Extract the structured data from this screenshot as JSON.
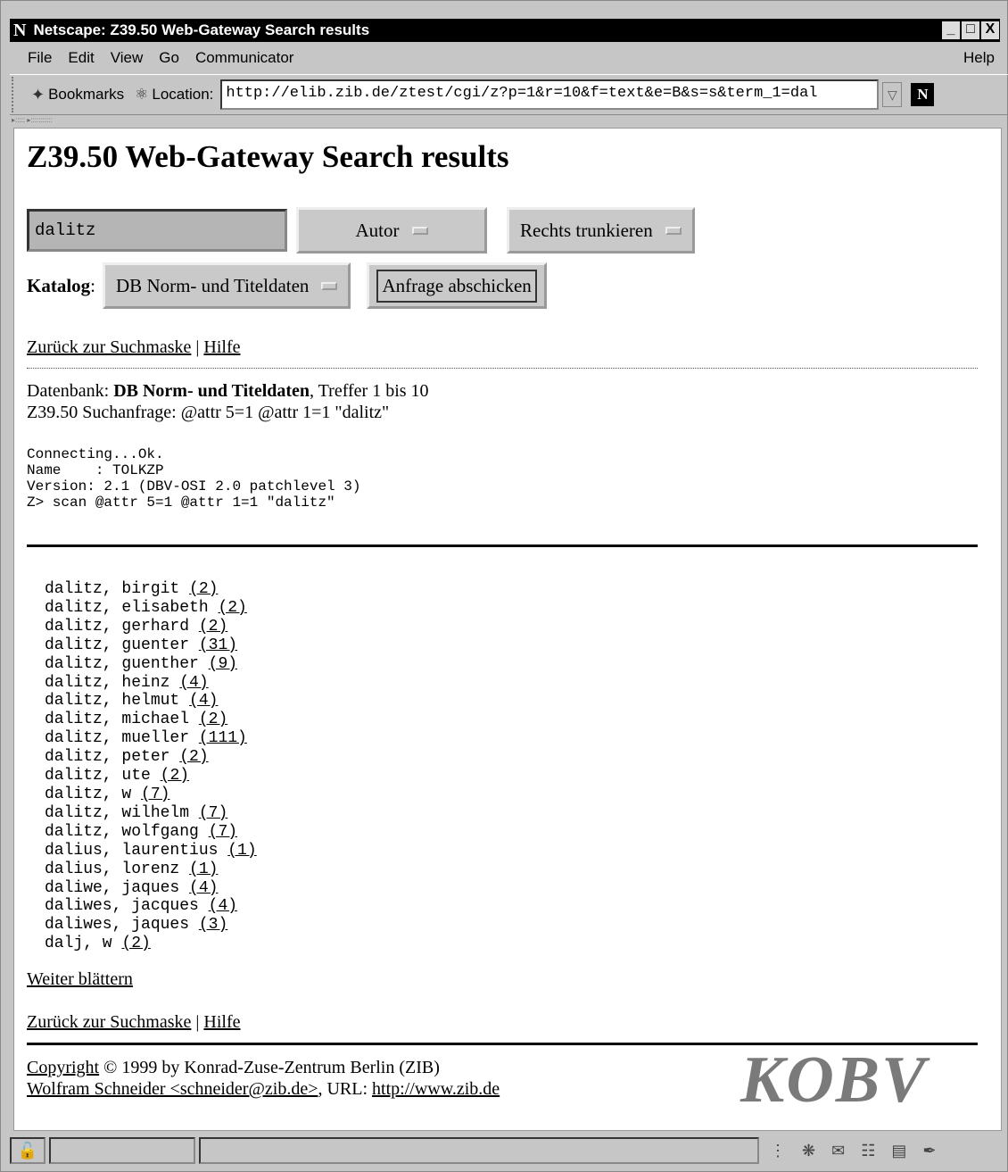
{
  "window": {
    "app_letter": "N",
    "title": "Netscape: Z39.50 Web-Gateway Search results",
    "buttons": [
      "_",
      "□",
      "X"
    ]
  },
  "menu": {
    "items": [
      "File",
      "Edit",
      "View",
      "Go",
      "Communicator"
    ],
    "help": "Help"
  },
  "toolbar": {
    "bookmarks_label": "Bookmarks",
    "location_label": "Location:",
    "url": "http://elib.zib.de/ztest/cgi/z?p=1&r=10&f=text&e=B&s=s&term_1=dal",
    "brand_badge": "N"
  },
  "page": {
    "heading": "Z39.50 Web-Gateway Search results",
    "search_term": "dalitz",
    "field_select": "Autor",
    "truncation_select": "Rechts trunkieren",
    "catalog_label": "Katalog",
    "catalog_select": "DB Norm- und Titeldaten",
    "submit_button": "Anfrage abschicken",
    "nav_back": "Zurück zur Suchmaske",
    "nav_sep": "|",
    "nav_help": "Hilfe",
    "db_prefix": "Datenbank: ",
    "db_name": "DB Norm- und Titeldaten",
    "hits": ", Treffer 1 bis 10",
    "query_line": "Z39.50 Suchanfrage: @attr 5=1 @attr 1=1 \"dalitz\"",
    "session_log": "Connecting...Ok.\nName    : TOLKZP\nVersion: 2.1 (DBV-OSI 2.0 patchlevel 3)\nZ> scan @attr 5=1 @attr 1=1 \"dalitz\"",
    "results": [
      {
        "term": "dalitz, birgit",
        "count": "(2)"
      },
      {
        "term": "dalitz, elisabeth",
        "count": "(2)"
      },
      {
        "term": "dalitz, gerhard",
        "count": "(2)"
      },
      {
        "term": "dalitz, guenter",
        "count": "(31)"
      },
      {
        "term": "dalitz, guenther",
        "count": "(9)"
      },
      {
        "term": "dalitz, heinz",
        "count": "(4)"
      },
      {
        "term": "dalitz, helmut",
        "count": "(4)"
      },
      {
        "term": "dalitz, michael",
        "count": "(2)"
      },
      {
        "term": "dalitz, mueller",
        "count": "(111)"
      },
      {
        "term": "dalitz, peter",
        "count": "(2)"
      },
      {
        "term": "dalitz, ute",
        "count": "(2)"
      },
      {
        "term": "dalitz, w",
        "count": "(7)"
      },
      {
        "term": "dalitz, wilhelm",
        "count": "(7)"
      },
      {
        "term": "dalitz, wolfgang",
        "count": "(7)"
      },
      {
        "term": "dalius, laurentius",
        "count": "(1)"
      },
      {
        "term": "dalius, lorenz",
        "count": "(1)"
      },
      {
        "term": "daliwe, jaques",
        "count": "(4)"
      },
      {
        "term": "daliwes, jacques",
        "count": "(4)"
      },
      {
        "term": "daliwes, jaques",
        "count": "(3)"
      },
      {
        "term": "dalj, w",
        "count": "(2)"
      }
    ],
    "next_page": "Weiter blättern",
    "footer_copyright_link": "Copyright",
    "footer_copyright_text": " © 1999 by Konrad-Zuse-Zentrum Berlin (ZIB)",
    "footer_author_link": "Wolfram Schneider <schneider@zib.de>",
    "footer_url_prefix": ", URL: ",
    "footer_url": "http://www.zib.de",
    "logo_text": "KOBV"
  }
}
